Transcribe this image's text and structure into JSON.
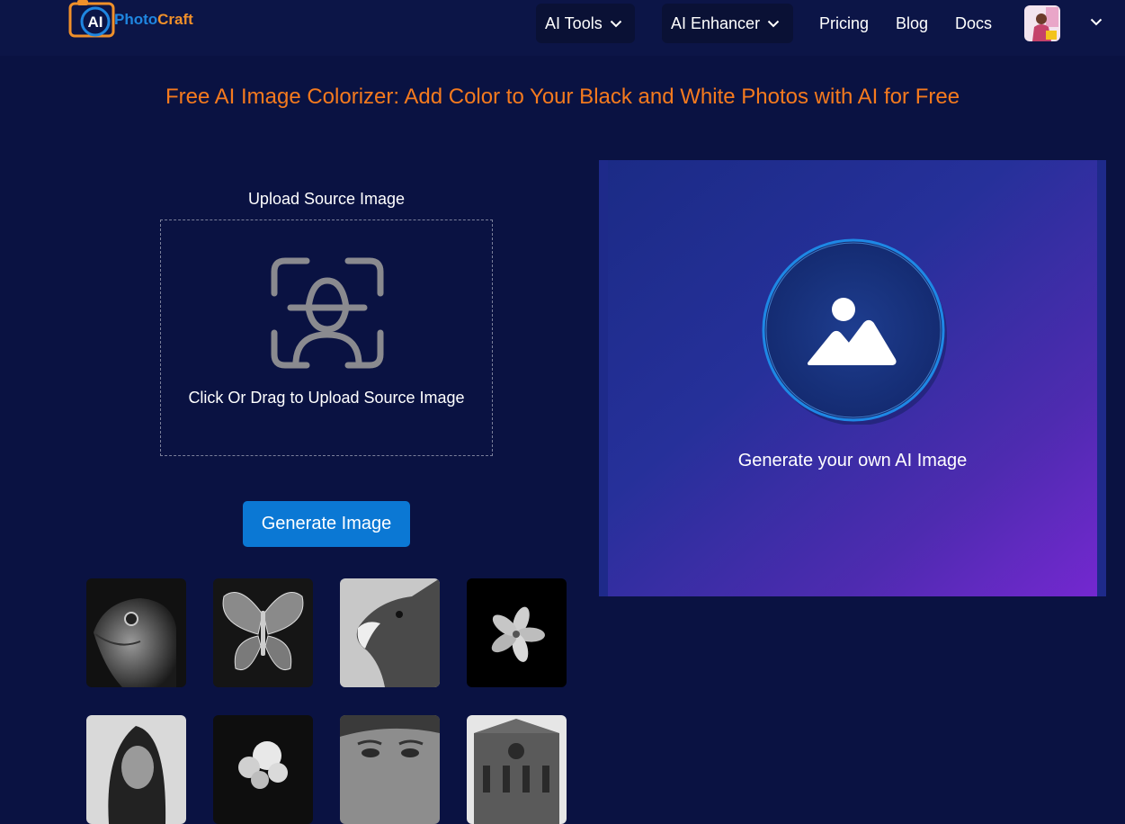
{
  "header": {
    "logo": {
      "badge": "AI",
      "name_part1": "Photo",
      "name_part2": "Craft"
    },
    "nav": {
      "ai_tools": "AI Tools",
      "ai_enhancer": "AI Enhancer",
      "pricing": "Pricing",
      "blog": "Blog",
      "docs": "Docs"
    }
  },
  "main": {
    "title": "Free AI Image Colorizer: Add Color to Your Black and White Photos with AI for Free",
    "upload": {
      "label": "Upload Source Image",
      "hint": "Click Or Drag to Upload Source Image"
    },
    "generate_button": "Generate Image",
    "samples": [
      "lizard",
      "butterfly",
      "eagle",
      "flower",
      "woman-portrait",
      "white-flowers",
      "face-closeup",
      "cathedral"
    ],
    "preview": {
      "caption": "Generate your own AI Image"
    }
  },
  "colors": {
    "background": "#0a1242",
    "title": "#f57a1e",
    "button": "#0b78d4",
    "logo_blue": "#1f86e0",
    "logo_orange": "#f0902a"
  }
}
